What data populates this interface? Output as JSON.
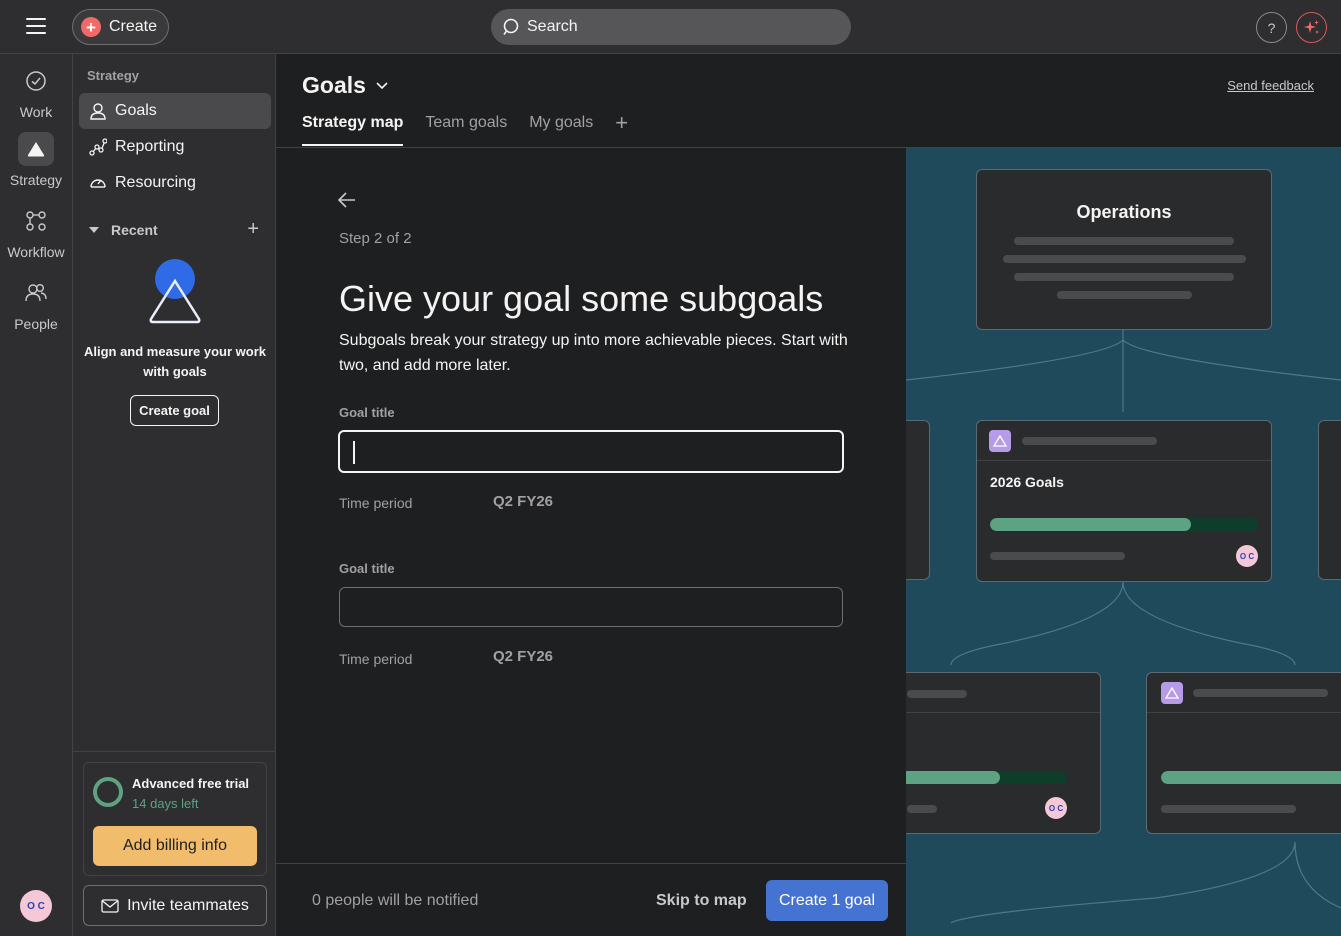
{
  "topbar": {
    "create_label": "Create",
    "search_placeholder": "Search",
    "help_label": "?"
  },
  "rail": {
    "items": [
      {
        "label": "Work"
      },
      {
        "label": "Strategy"
      },
      {
        "label": "Workflow"
      },
      {
        "label": "People"
      }
    ],
    "avatar_initials": "O C"
  },
  "sidebar": {
    "section": "Strategy",
    "items": [
      {
        "label": "Goals"
      },
      {
        "label": "Reporting"
      },
      {
        "label": "Resourcing"
      }
    ],
    "recent_label": "Recent",
    "empty_text": "Align and measure your work with goals",
    "create_goal_label": "Create goal",
    "trial": {
      "title": "Advanced free trial",
      "days_left": "14 days left",
      "billing_label": "Add billing info"
    },
    "invite_label": "Invite teammates"
  },
  "header": {
    "title": "Goals",
    "send_feedback": "Send feedback",
    "tabs": [
      {
        "label": "Strategy map"
      },
      {
        "label": "Team goals"
      },
      {
        "label": "My goals"
      }
    ]
  },
  "form": {
    "step": "Step 2 of 2",
    "heading": "Give your goal some subgoals",
    "description": "Subgoals break your strategy up into more achievable pieces. Start with two, and add more later.",
    "subgoals": [
      {
        "title_label": "Goal title",
        "title_value": "",
        "time_label": "Time period",
        "time_value": "Q2 FY26"
      },
      {
        "title_label": "Goal title",
        "title_value": "",
        "time_label": "Time period",
        "time_value": "Q2 FY26"
      }
    ],
    "notify_text": "0 people will be notified",
    "skip_label": "Skip to map",
    "create_label": "Create 1 goal"
  },
  "map": {
    "top_card_title": "Operations",
    "center_card_title": "2026 Goals",
    "center_progress": 0.75,
    "left_bottom_progress": 0.63,
    "avatar_initials": "O C",
    "colors": {
      "background": "#1f4a5c",
      "progress": "#5da283",
      "goal_icon": "#b79be8"
    }
  }
}
